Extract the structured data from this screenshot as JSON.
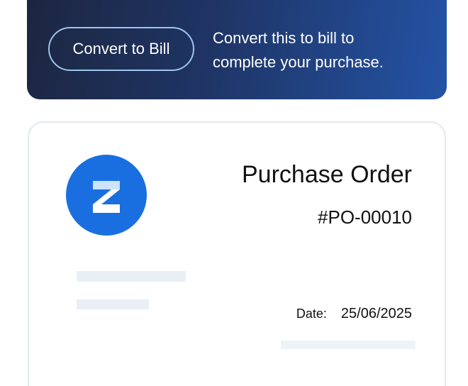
{
  "banner": {
    "button_label": "Convert to Bill",
    "message_line1": "Convert this to bill to",
    "message_line2": "complete your purchase."
  },
  "document": {
    "logo_letter": "Z",
    "title": "Purchase Order",
    "number": "#PO-00010",
    "date_label": "Date:",
    "date_value": "25/06/2025"
  },
  "colors": {
    "banner_gradient_start": "#1c2640",
    "banner_gradient_end": "#2453a6",
    "button_border": "#9dc4ee",
    "logo_background": "#1a6fe0",
    "placeholder": "#e9eff5"
  }
}
